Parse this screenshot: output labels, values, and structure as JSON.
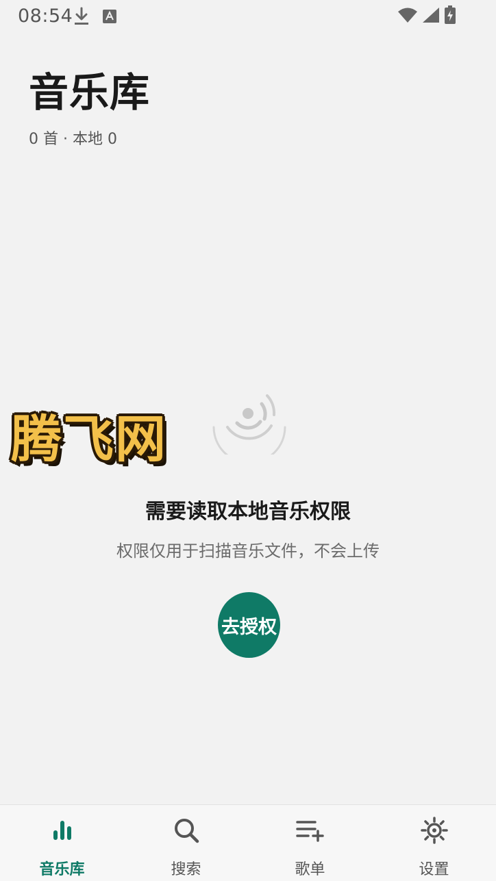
{
  "status_bar": {
    "time": "08:54",
    "left_icons": [
      "download-icon",
      "keyboard-a-icon"
    ],
    "right_icons": [
      "wifi-icon",
      "signal-icon",
      "battery-charging-icon"
    ]
  },
  "header": {
    "title": "音乐库",
    "subtitle": "0 首 · 本地 0"
  },
  "watermark": {
    "text": "腾飞网"
  },
  "empty_state": {
    "icon": "radio-waves-icon",
    "title": "需要读取本地音乐权限",
    "description": "权限仅用于扫描音乐文件，不会上传",
    "button_label": "去授权"
  },
  "bottom_nav": {
    "items": [
      {
        "label": "音乐库",
        "icon": "bar-chart-icon",
        "active": true
      },
      {
        "label": "搜索",
        "icon": "search-icon",
        "active": false
      },
      {
        "label": "歌单",
        "icon": "playlist-add-icon",
        "active": false
      },
      {
        "label": "设置",
        "icon": "gear-icon",
        "active": false
      }
    ]
  },
  "colors": {
    "accent": "#0f7a66",
    "background": "#f2f2f2",
    "text_primary": "#1a1a1a",
    "text_secondary": "#6b6b6b"
  }
}
